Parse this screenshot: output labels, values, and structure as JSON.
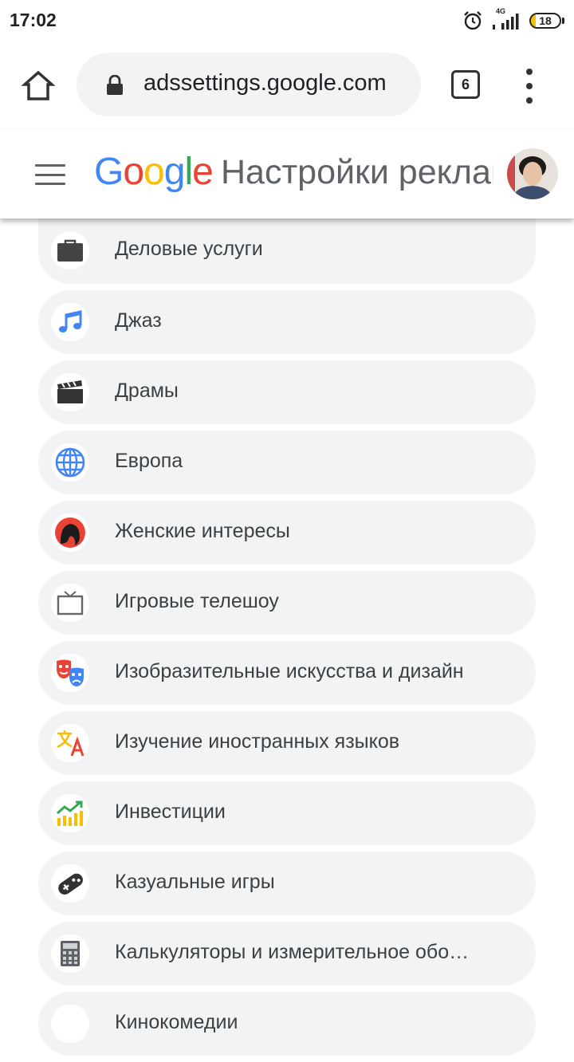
{
  "status_bar": {
    "time": "17:02",
    "network": "4G",
    "battery_level": "18",
    "battery_fraction": 0.18,
    "icons": [
      "alarm-icon",
      "signal-icon",
      "battery-icon"
    ]
  },
  "browser": {
    "url": "adssettings.google.com",
    "tab_count": "6",
    "icons": [
      "home-icon",
      "lock-icon",
      "tabs-icon",
      "more-vert-icon"
    ]
  },
  "header": {
    "logo": "Google",
    "title": "Настройки рекламы"
  },
  "colors": {
    "google_blue": "#4285f4",
    "google_red": "#ea4335",
    "google_yellow": "#fbbc05",
    "google_green": "#34a853",
    "row_background": "#f1f3f4"
  },
  "items": [
    {
      "label": "Деловые услуги",
      "icon": "briefcase-icon"
    },
    {
      "label": "Джаз",
      "icon": "music-note-icon"
    },
    {
      "label": "Драмы",
      "icon": "clapperboard-icon"
    },
    {
      "label": "Европа",
      "icon": "globe-icon"
    },
    {
      "label": "Женские интересы",
      "icon": "woman-icon"
    },
    {
      "label": "Игровые телешоу",
      "icon": "tv-icon"
    },
    {
      "label": "Изобразительные искусства и дизайн",
      "icon": "theater-masks-icon"
    },
    {
      "label": "Изучение иностранных языков",
      "icon": "translate-icon"
    },
    {
      "label": "Инвестиции",
      "icon": "chart-growth-icon"
    },
    {
      "label": "Казуальные игры",
      "icon": "gamepad-icon"
    },
    {
      "label": "Калькуляторы и измерительное обо…",
      "icon": "calculator-icon"
    },
    {
      "label": "Кинокомедии",
      "icon": "comedy-icon"
    }
  ]
}
